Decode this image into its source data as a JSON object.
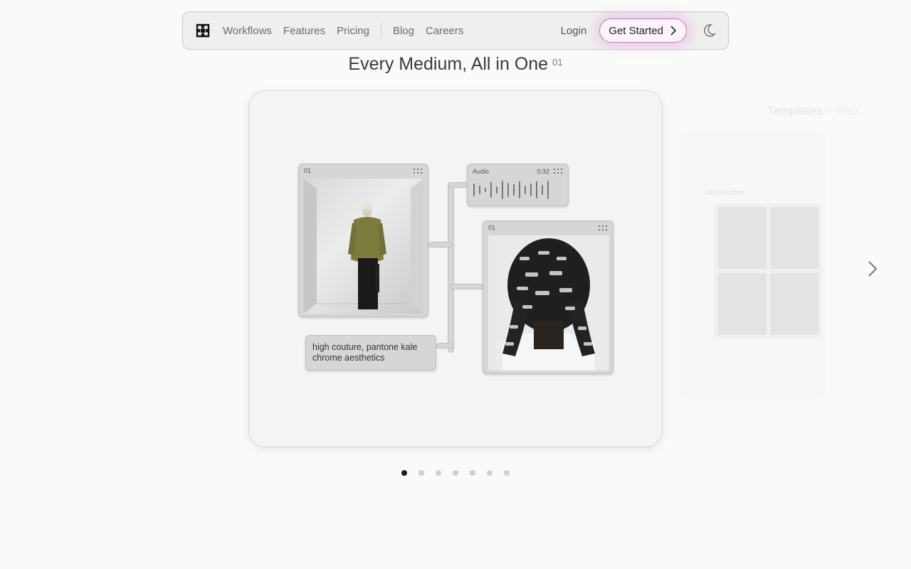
{
  "nav": {
    "logo_icon": "puzzle-logo-icon",
    "links": [
      "Workflows",
      "Features",
      "Pricing"
    ],
    "secondary_links": [
      "Blog",
      "Careers"
    ],
    "login": "Login",
    "cta": "Get Started",
    "cta_icon": "chevron-right-icon",
    "theme_icon": "moon-icon",
    "accent": "#c37ab8"
  },
  "hero": {
    "title": "Every Medium, All in One",
    "index": "01"
  },
  "card": {
    "image_tile": {
      "num": "01"
    },
    "audio_tile": {
      "label": "Audio",
      "time": "0:32"
    },
    "braids_tile": {
      "num": "01"
    },
    "prompt": "high couture, pantone kale chrome aesthetics"
  },
  "side_preview": {
    "title": "Templates",
    "title_extra": "+ Reu",
    "tag": "Art Direction"
  },
  "pager": {
    "count": 7,
    "active": 0
  }
}
